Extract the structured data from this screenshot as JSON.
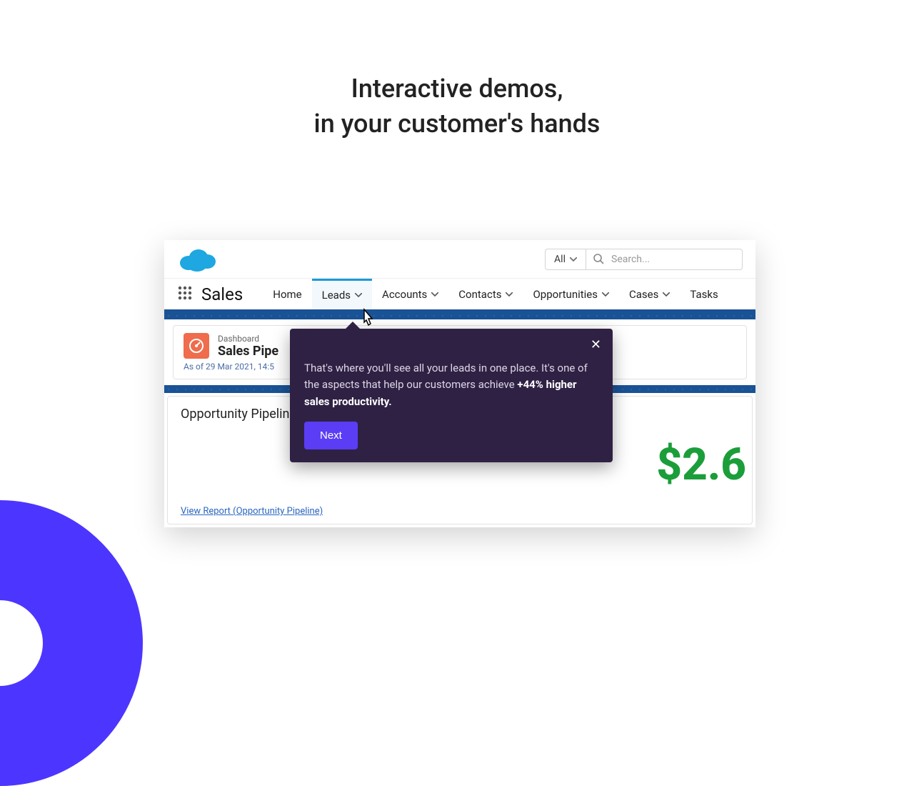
{
  "hero": {
    "line1": "Interactive demos,",
    "line2": "in your customer's hands"
  },
  "search": {
    "scope": "All",
    "placeholder": "Search..."
  },
  "app_title": "Sales",
  "nav": {
    "home": "Home",
    "leads": "Leads",
    "accounts": "Accounts",
    "contacts": "Contacts",
    "opportunities": "Opportunities",
    "cases": "Cases",
    "tasks": "Tasks"
  },
  "dashboard": {
    "label": "Dashboard",
    "title": "Sales Pipe",
    "as_of": "As of 29 Mar 2021, 14:5"
  },
  "pipeline": {
    "title": "Opportunity Pipelin",
    "big_value": "$2.6",
    "report_link": "View Report (Opportunity Pipeline) "
  },
  "tooltip": {
    "body_plain": "That's where you'll see all your leads in one place. It's one of the aspects that help our customers achieve ",
    "body_bold": "+44%  higher sales productivity.",
    "next": "Next"
  }
}
